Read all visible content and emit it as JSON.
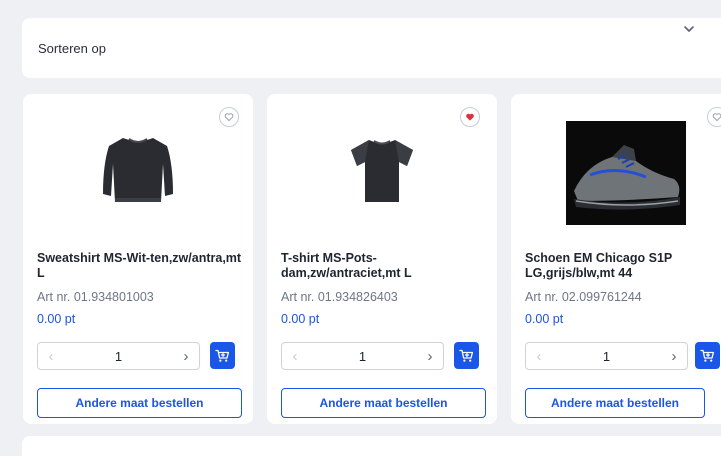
{
  "sort": {
    "label": "Sorteren op"
  },
  "products": [
    {
      "name": "Sweatshirt MS-Wit-ten,zw/antra,mt L",
      "art_nr": "Art nr. 01.934801003",
      "points": "0.00 pt",
      "quantity": "1",
      "favorite": false,
      "other_size_label": "Andere maat bestellen",
      "image_icon": "sweatshirt-image"
    },
    {
      "name": "T-shirt MS-Pots-dam,zw/antraciet,mt L",
      "art_nr": "Art nr. 01.934826403",
      "points": "0.00 pt",
      "quantity": "1",
      "favorite": true,
      "other_size_label": "Andere maat bestellen",
      "image_icon": "tshirt-image"
    },
    {
      "name": "Schoen EM Chicago S1P LG,grijs/blw,mt 44",
      "art_nr": "Art nr. 02.099761244",
      "points": "0.00 pt",
      "quantity": "1",
      "favorite": false,
      "other_size_label": "Andere maat bestellen",
      "image_icon": "shoe-image"
    }
  ],
  "colors": {
    "accent": "#1a56e8",
    "points": "#1a56d6",
    "favorite_active": "#e0303c"
  }
}
